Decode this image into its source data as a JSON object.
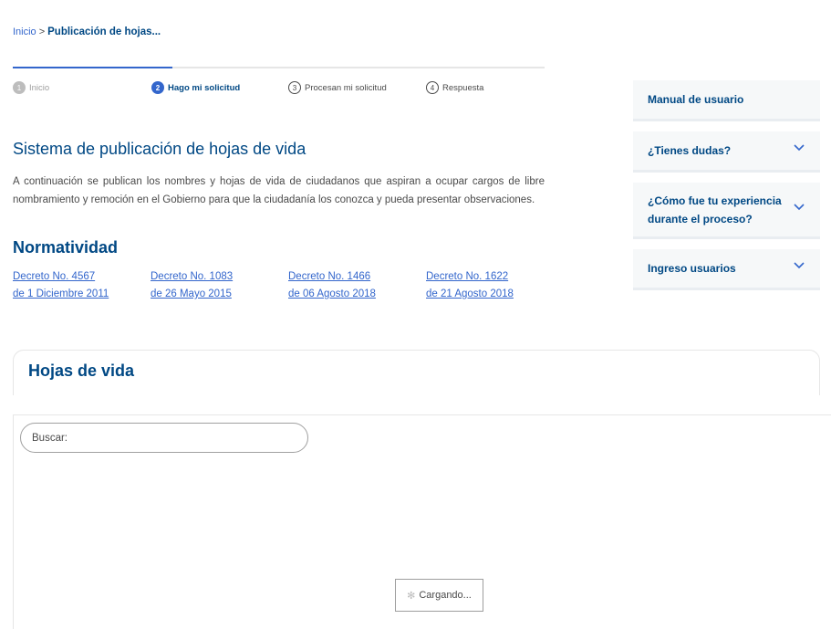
{
  "breadcrumb": {
    "home": "Inicio",
    "separator": ">",
    "current": "Publicación de hojas..."
  },
  "stepper": {
    "steps": [
      {
        "number": "1",
        "label": "Inicio",
        "state": "done"
      },
      {
        "number": "2",
        "label": "Hago mi solicitud",
        "state": "active"
      },
      {
        "number": "3",
        "label": "Procesan mi solicitud",
        "state": "pending"
      },
      {
        "number": "4",
        "label": "Respuesta",
        "state": "pending"
      }
    ]
  },
  "main": {
    "title": "Sistema de publicación de hojas de vida",
    "intro": "A continuación se publican los nombres y hojas de vida de ciudadanos que aspiran a ocupar cargos de libre nombramiento y remoción en el Gobierno para que la ciudadanía los conozca y pueda presentar observaciones.",
    "normatividad_title": "Normatividad",
    "decrees": [
      {
        "line1": "Decreto No. 4567",
        "line2": "de 1 Diciembre 2011"
      },
      {
        "line1": "Decreto No. 1083",
        "line2": "de 26 Mayo 2015"
      },
      {
        "line1": "Decreto No. 1466",
        "line2": "de 06 Agosto 2018"
      },
      {
        "line1": "Decreto No. 1622",
        "line2": "de 21 Agosto 2018"
      }
    ]
  },
  "sidebar": {
    "items": [
      {
        "label": "Manual de usuario"
      },
      {
        "label": "¿Tienes dudas?"
      },
      {
        "label": "¿Cómo fue tu experiencia durante el proceso?"
      },
      {
        "label": "Ingreso usuarios"
      }
    ]
  },
  "hojas": {
    "title": "Hojas de vida",
    "search_placeholder": "Buscar:",
    "loading_text": "Cargando..."
  },
  "colors": {
    "primary": "#004884",
    "link": "#3366cc",
    "text": "#4b4b4b"
  }
}
